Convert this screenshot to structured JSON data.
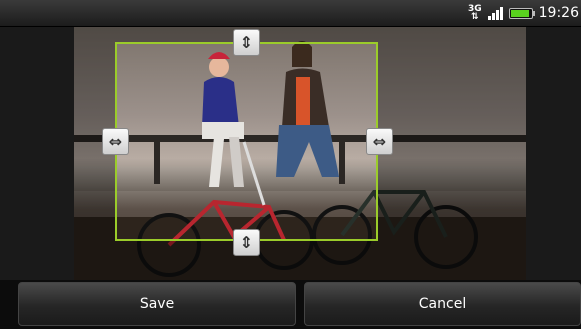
{
  "status_bar": {
    "network_type": "3G",
    "clock": "19:26",
    "battery_level": 0.9,
    "signal_bars": 4
  },
  "actions": {
    "save_label": "Save",
    "cancel_label": "Cancel"
  },
  "colors": {
    "crop_border": "#9bcc2a",
    "battery_fill": "#59d11e"
  },
  "icons": {
    "top_handle": "vertical-resize-icon",
    "bottom_handle": "vertical-resize-icon",
    "left_handle": "horizontal-resize-icon",
    "right_handle": "horizontal-resize-icon"
  }
}
